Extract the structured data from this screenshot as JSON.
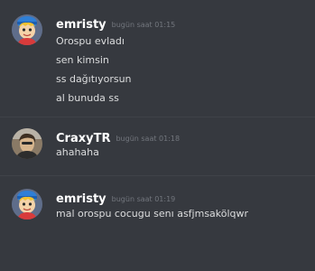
{
  "messages": [
    {
      "username": "emristy",
      "timestamp": "bugün saat 01:15",
      "avatar_icon": "cartoon-boy-blue-hat-avatar",
      "lines": [
        "Orospu evladı",
        "sen kimsin",
        "ss dağıtıyorsun",
        "al bunuda ss"
      ]
    },
    {
      "username": "CraxyTR",
      "timestamp": "bugün saat 01:18",
      "avatar_icon": "photo-person-avatar",
      "lines": [
        "ahahaha"
      ]
    },
    {
      "username": "emristy",
      "timestamp": "bugün saat 01:19",
      "avatar_icon": "cartoon-boy-blue-hat-avatar",
      "lines": [
        "mal orospu cocugu senı asfjmsakölqwr"
      ]
    }
  ],
  "colors": {
    "background": "#36393f",
    "username": "#ffffff",
    "text": "#dcddde",
    "timestamp": "#72767d"
  }
}
